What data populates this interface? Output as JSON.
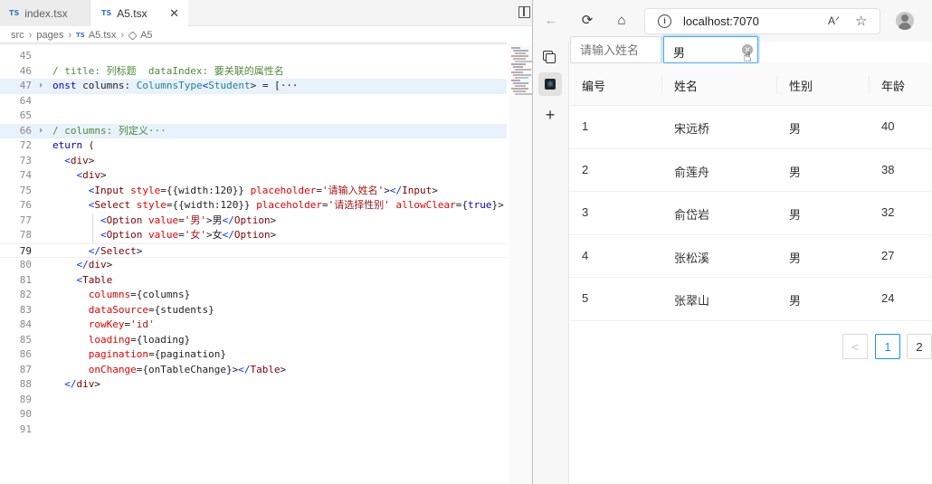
{
  "editor": {
    "tabs": [
      {
        "label": "index.tsx",
        "badge": "TS"
      },
      {
        "label": "A5.tsx",
        "badge": "TS",
        "close": "✕"
      }
    ],
    "breadcrumb": [
      "src",
      "pages",
      "A5.tsx",
      "A5"
    ],
    "lines": [
      {
        "n": "45",
        "text": ""
      },
      {
        "n": "46",
        "text": "/ title: 列标题  dataIndex: 要关联的属性名"
      },
      {
        "n": "47",
        "text": "onst columns: ColumnsType<Student> = [···"
      },
      {
        "n": "64",
        "text": ""
      },
      {
        "n": "65",
        "text": ""
      },
      {
        "n": "66",
        "text": "/ columns: 列定义···"
      },
      {
        "n": "72",
        "text": "eturn ("
      },
      {
        "n": "73",
        "text": "<div>"
      },
      {
        "n": "74",
        "text": "<div>"
      },
      {
        "n": "75",
        "text": "<Input style={{width:120}} placeholder='请输入姓名'></Input>"
      },
      {
        "n": "76",
        "text": "<Select style={{width:120}} placeholder='请选择性别' allowClear={true}>"
      },
      {
        "n": "77",
        "text": "<Option value='男'>男</Option>"
      },
      {
        "n": "78",
        "text": "<Option value='女'>女</Option>"
      },
      {
        "n": "79",
        "text": "</Select>"
      },
      {
        "n": "80",
        "text": "</div>"
      },
      {
        "n": "81",
        "text": "<Table"
      },
      {
        "n": "82",
        "text": "columns={columns}"
      },
      {
        "n": "83",
        "text": "dataSource={students}"
      },
      {
        "n": "84",
        "text": "rowKey='id'"
      },
      {
        "n": "85",
        "text": "loading={loading}"
      },
      {
        "n": "86",
        "text": "pagination={pagination}"
      },
      {
        "n": "87",
        "text": "onChange={onTableChange}></Table>"
      },
      {
        "n": "88",
        "text": "</div>"
      },
      {
        "n": "89",
        "text": ""
      },
      {
        "n": "90",
        "text": ""
      },
      {
        "n": "91",
        "text": ""
      }
    ]
  },
  "browser": {
    "url": "localhost:7070",
    "icons": [
      "back-arrow",
      "reload",
      "home",
      "info",
      "read-aloud",
      "favorites-star",
      "profile",
      "tabs",
      "react-devtools",
      "new-tab"
    ]
  },
  "app": {
    "name_placeholder": "请输入姓名",
    "gender_value": "男",
    "columns": [
      "编号",
      "姓名",
      "性别",
      "年龄"
    ],
    "rows": [
      {
        "id": "1",
        "name": "宋远桥",
        "gender": "男",
        "age": "40"
      },
      {
        "id": "2",
        "name": "俞莲舟",
        "gender": "男",
        "age": "38"
      },
      {
        "id": "3",
        "name": "俞岱岩",
        "gender": "男",
        "age": "32"
      },
      {
        "id": "4",
        "name": "张松溪",
        "gender": "男",
        "age": "27"
      },
      {
        "id": "5",
        "name": "张翠山",
        "gender": "男",
        "age": "24"
      }
    ],
    "pagination": {
      "prev": "<",
      "pages": [
        "1",
        "2"
      ],
      "current": "1"
    }
  },
  "colors": {
    "accent": "#1890ff",
    "comment": "#4f8a3a",
    "tag": "#800000",
    "attribute": "#e50000"
  }
}
